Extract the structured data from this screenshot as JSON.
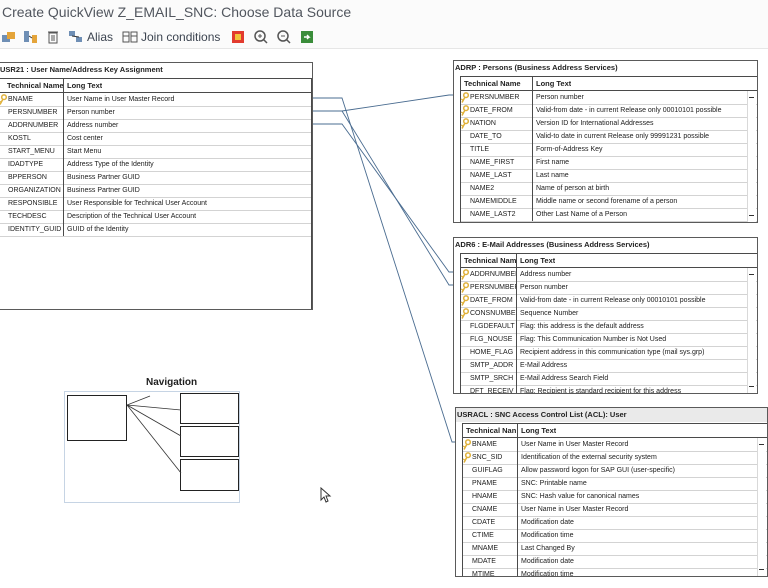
{
  "window": {
    "title": "Create QuickView Z_EMAIL_SNC: Choose Data Source"
  },
  "toolbar": {
    "alias_label": "Alias",
    "join_label": "Join conditions",
    "icons": [
      "add-table-icon",
      "join-tables-icon",
      "delete-icon",
      "alias-icon",
      "join-conditions-icon",
      "color-legend-icon",
      "zoom-in-icon",
      "zoom-out-icon",
      "export-icon"
    ]
  },
  "headers": {
    "technical_name": "Technical Name",
    "long_text": "Long Text"
  },
  "tables": [
    {
      "title": "USR21 : User Name/Address Key Assignment",
      "technical_header": "Technical Name",
      "rows": [
        {
          "name": "BNAME",
          "text": "User Name in User Master Record",
          "key": true
        },
        {
          "name": "PERSNUMBER",
          "text": "Person number",
          "key": false
        },
        {
          "name": "ADDRNUMBER",
          "text": "Address number",
          "key": false
        },
        {
          "name": "KOSTL",
          "text": "Cost center",
          "key": false
        },
        {
          "name": "START_MENU",
          "text": "Start Menu",
          "key": false
        },
        {
          "name": "IDADTYPE",
          "text": "Address Type of the Identity",
          "key": false
        },
        {
          "name": "BPPERSON",
          "text": "Business Partner GUID",
          "key": false
        },
        {
          "name": "ORGANIZATION",
          "text": "Business Partner GUID",
          "key": false
        },
        {
          "name": "RESPONSIBLE",
          "text": "User Responsible for Technical User Account",
          "key": false
        },
        {
          "name": "TECHDESC",
          "text": "Description of the Technical User Account",
          "key": false
        },
        {
          "name": "IDENTITY_GUID",
          "text": "GUID of the Identity",
          "key": false
        }
      ]
    },
    {
      "title": "ADRP : Persons (Business Address Services)",
      "technical_header": "Technical Name",
      "rows": [
        {
          "name": "PERSNUMBER",
          "text": "Person number",
          "key": true
        },
        {
          "name": "DATE_FROM",
          "text": "Valid-from date - in current Release only 00010101 possible",
          "key": true
        },
        {
          "name": "NATION",
          "text": "Version ID for International Addresses",
          "key": true
        },
        {
          "name": "DATE_TO",
          "text": "Valid-to date in current Release only 99991231 possible",
          "key": false
        },
        {
          "name": "TITLE",
          "text": "Form-of-Address Key",
          "key": false
        },
        {
          "name": "NAME_FIRST",
          "text": "First name",
          "key": false
        },
        {
          "name": "NAME_LAST",
          "text": "Last name",
          "key": false
        },
        {
          "name": "NAME2",
          "text": "Name of person at birth",
          "key": false
        },
        {
          "name": "NAMEMIDDLE",
          "text": "Middle name or second forename of a person",
          "key": false
        },
        {
          "name": "NAME_LAST2",
          "text": "Other Last Name of a Person",
          "key": false
        }
      ]
    },
    {
      "title": "ADR6 : E-Mail Addresses (Business Address Services)",
      "technical_header": "Technical Nam",
      "rows": [
        {
          "name": "ADDRNUMBER",
          "text": "Address number",
          "key": true
        },
        {
          "name": "PERSNUMBER",
          "text": "Person number",
          "key": true
        },
        {
          "name": "DATE_FROM",
          "text": "Valid-from date - in current Release only 00010101 possible",
          "key": true
        },
        {
          "name": "CONSNUMBER",
          "text": "Sequence Number",
          "key": true
        },
        {
          "name": "FLGDEFAULT",
          "text": "Flag: this address is the default address",
          "key": false
        },
        {
          "name": "FLG_NOUSE",
          "text": "Flag: This Communication Number is Not Used",
          "key": false
        },
        {
          "name": "HOME_FLAG",
          "text": "Recipient address in this communication type (mail sys.grp)",
          "key": false
        },
        {
          "name": "SMTP_ADDR",
          "text": "E-Mail Address",
          "key": false
        },
        {
          "name": "SMTP_SRCH",
          "text": "E-Mail Address Search Field",
          "key": false
        },
        {
          "name": "DFT_RECEIV",
          "text": "Flag: Recipient is standard recipient for this address",
          "key": false
        }
      ]
    },
    {
      "title": "USRACL : SNC Access Control List (ACL): User",
      "technical_header": "Technical Nan",
      "rows": [
        {
          "name": "BNAME",
          "text": "User Name in User Master Record",
          "key": true
        },
        {
          "name": "SNC_SID",
          "text": "Identification of the external security system",
          "key": true
        },
        {
          "name": "GUIFLAG",
          "text": "Allow password logon for SAP GUI (user-specific)",
          "key": false
        },
        {
          "name": "PNAME",
          "text": "SNC: Printable name",
          "key": false
        },
        {
          "name": "HNAME",
          "text": "SNC: Hash value for canonical names",
          "key": false
        },
        {
          "name": "CNAME",
          "text": "User Name in User Master Record",
          "key": false
        },
        {
          "name": "CDATE",
          "text": "Modification date",
          "key": false
        },
        {
          "name": "CTIME",
          "text": "Modification time",
          "key": false
        },
        {
          "name": "MNAME",
          "text": "Last Changed By",
          "key": false
        },
        {
          "name": "MDATE",
          "text": "Modification date",
          "key": false
        },
        {
          "name": "MTIME",
          "text": "Modification time",
          "key": false
        }
      ]
    }
  ],
  "navigation": {
    "title": "Navigation"
  },
  "colors": {
    "line": "#4a6c90",
    "key": "#e0b13a",
    "nav_frame": "#c6d4e4"
  }
}
